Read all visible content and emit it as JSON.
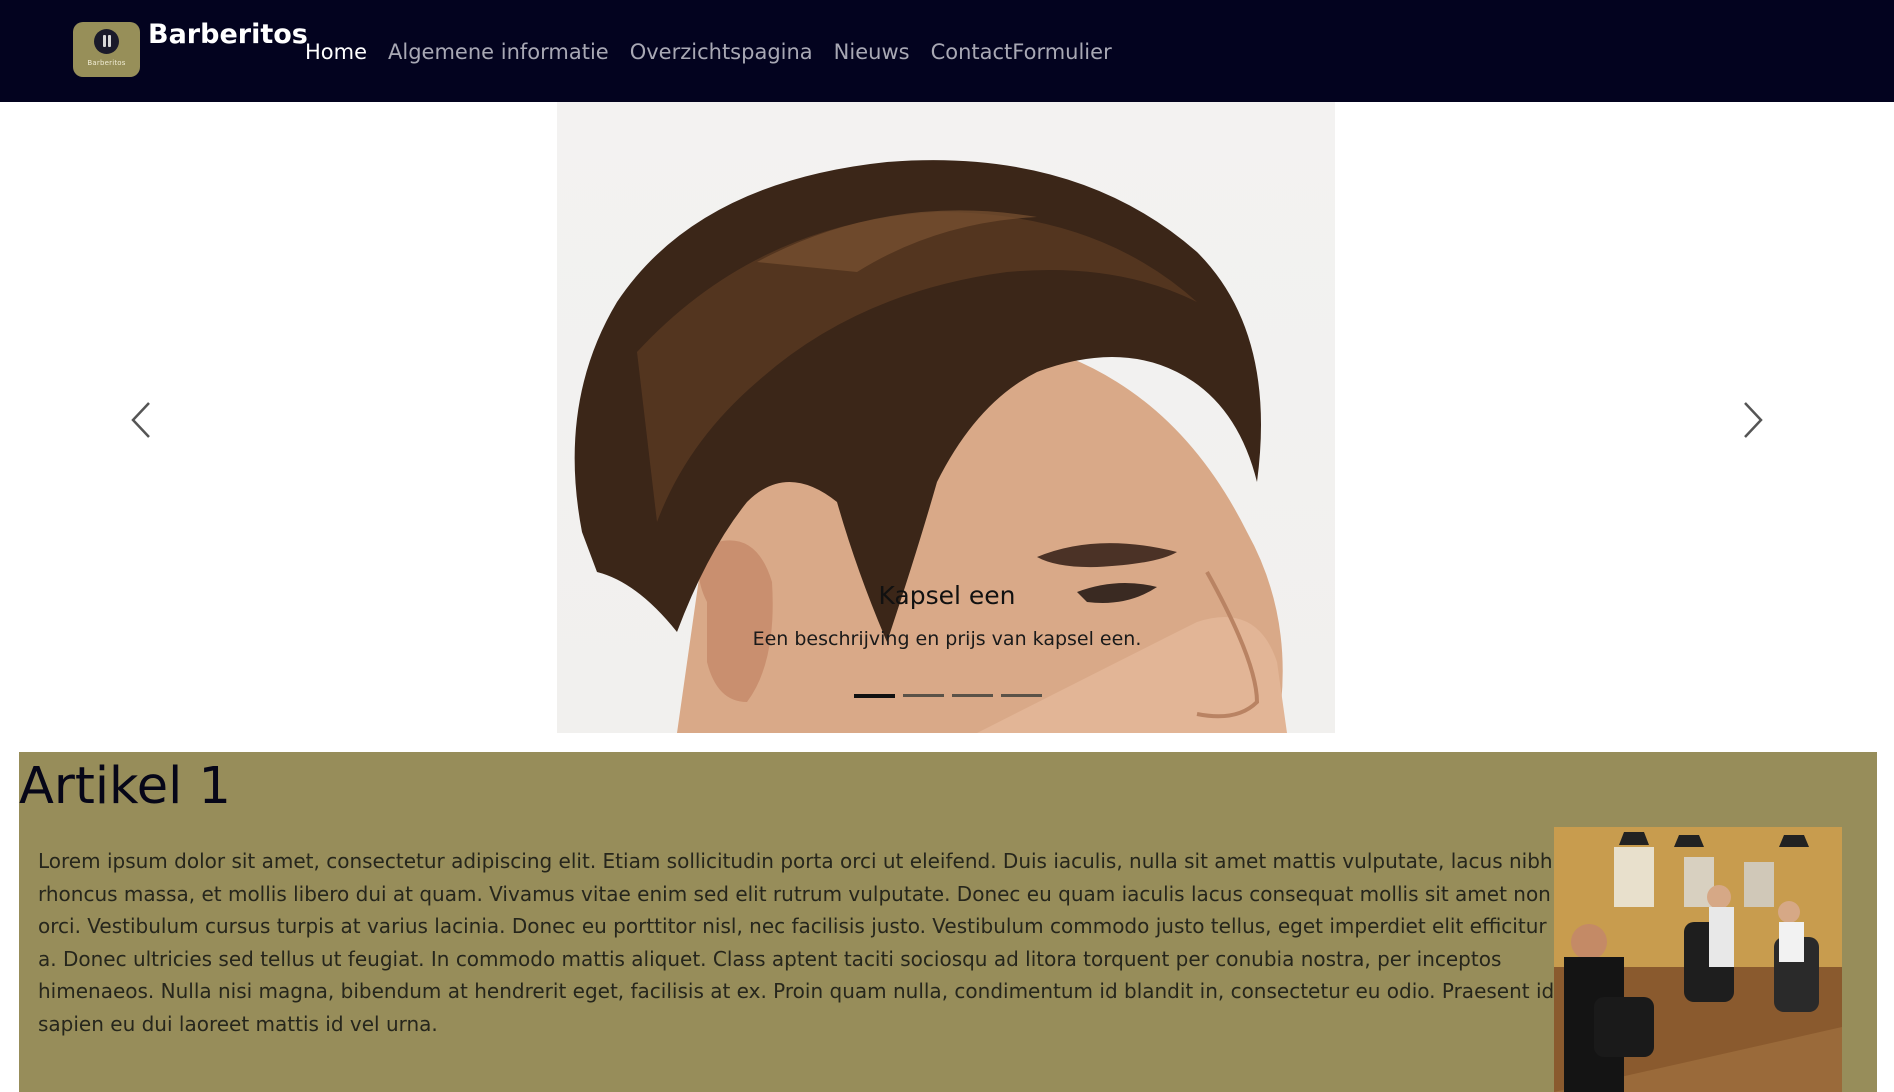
{
  "brand": {
    "logo_text": "Barberitos",
    "name": "Barberitos"
  },
  "nav": {
    "items": [
      {
        "label": "Home",
        "active": true
      },
      {
        "label": "Algemene informatie",
        "active": false
      },
      {
        "label": "Overzichtspagina",
        "active": false
      },
      {
        "label": "Nieuws",
        "active": false
      },
      {
        "label": "ContactFormulier",
        "active": false
      }
    ]
  },
  "carousel": {
    "caption_title": "Kapsel een",
    "caption_text": "Een beschrijving en prijs van kapsel een.",
    "slide_count": 4,
    "active_index": 0,
    "prev_icon": "chevron-left-icon",
    "next_icon": "chevron-right-icon"
  },
  "article": {
    "title": "Artikel 1",
    "body": "Lorem ipsum dolor sit amet, consectetur adipiscing elit. Etiam sollicitudin porta orci ut eleifend. Duis iaculis, nulla sit amet mattis vulputate, lacus nibh rhoncus massa, et mollis libero dui at quam. Vivamus vitae enim sed elit rutrum vulputate. Donec eu quam iaculis lacus consequat mollis sit amet non orci. Vestibulum cursus turpis at varius lacinia. Donec eu porttitor nisl, nec facilisis justo. Vestibulum commodo justo tellus, eget imperdiet elit efficitur a. Donec ultricies sed tellus ut feugiat. In commodo mattis aliquet. Class aptent taciti sociosqu ad litora torquent per conubia nostra, per inceptos himenaeos. Nulla nisi magna, bibendum at hendrerit eget, facilisis at ex. Proin quam nulla, condimentum id blandit in, consectetur eu odio. Praesent id sapien eu dui laoreet mattis id vel urna."
  },
  "colors": {
    "navbar_bg": "#03031f",
    "accent_olive": "#978d5a",
    "nav_active": "#ffffff",
    "nav_inactive": "#a8a8b4"
  }
}
